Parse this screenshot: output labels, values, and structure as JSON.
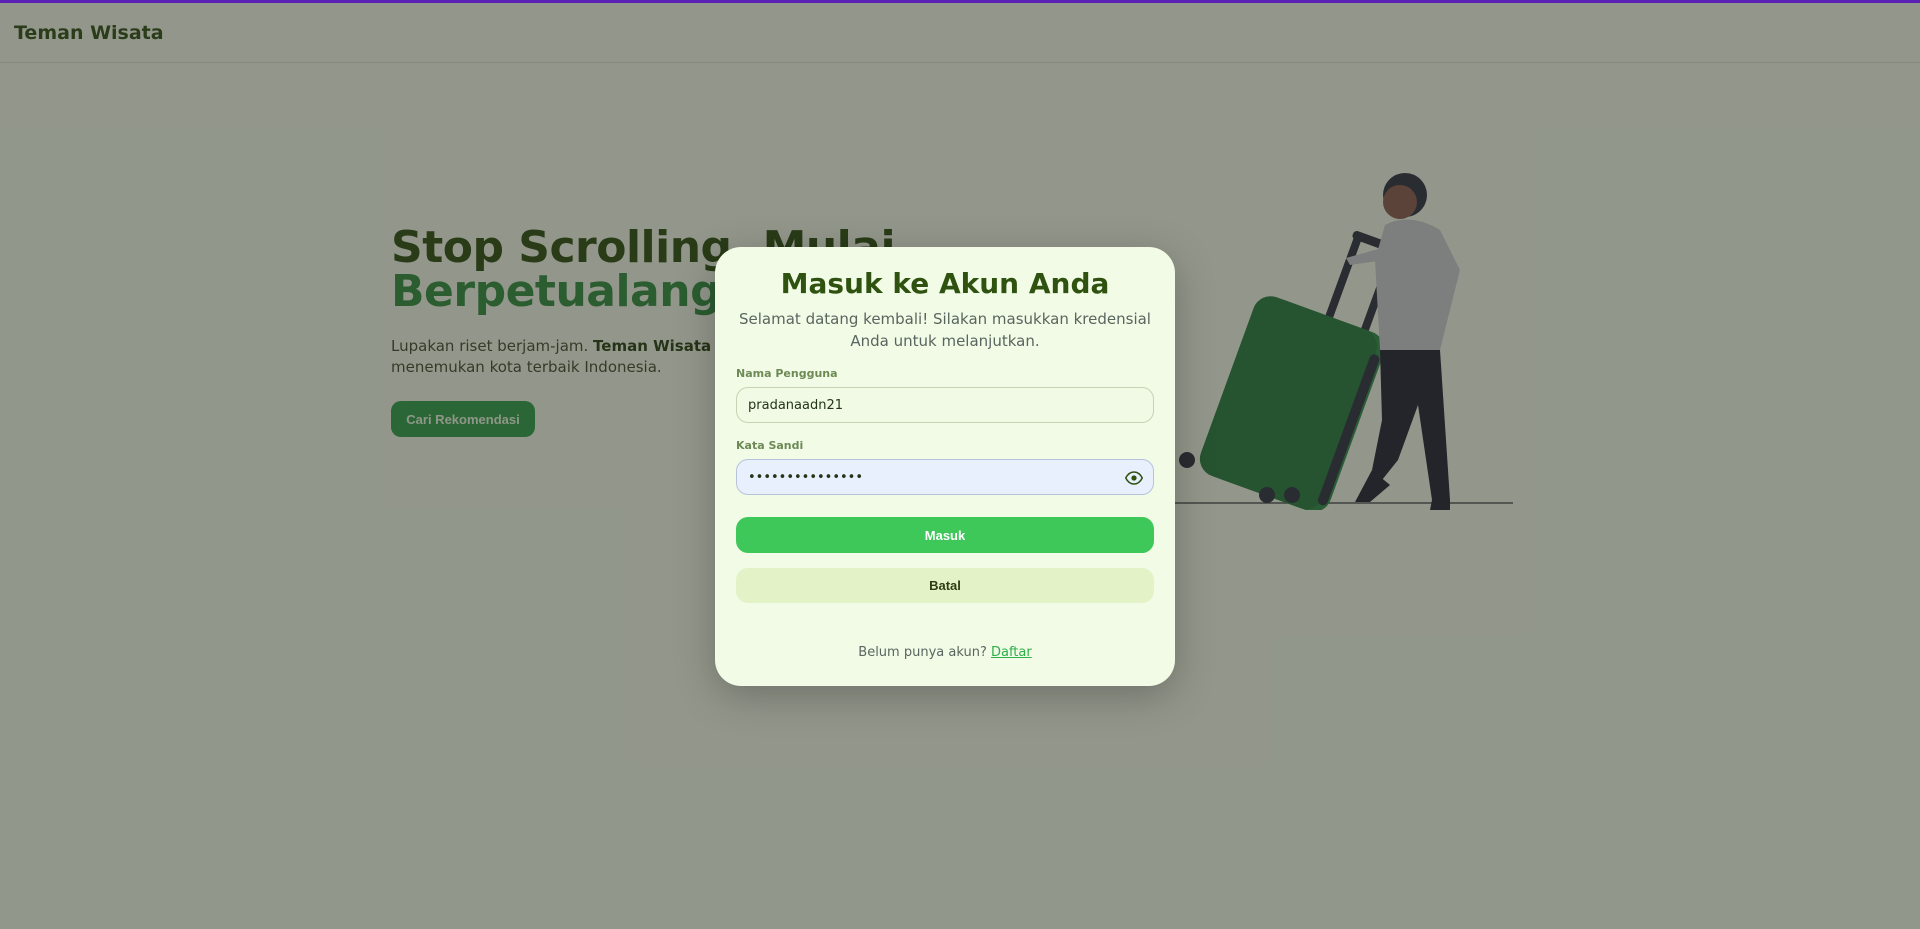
{
  "navbar": {
    "brand": "Teman Wisata"
  },
  "hero": {
    "title_line1": "Stop Scrolling, Mulai",
    "title_line2": "Berpetualang",
    "desc_prefix": "Lupakan riset berjam-jam. ",
    "desc_brand": "Teman Wisata",
    "desc_suffix": " menemukan kota terbaik Indonesia.",
    "cta_label": "Cari Rekomendasi"
  },
  "modal": {
    "title": "Masuk ke Akun Anda",
    "subtitle": "Selamat datang kembali! Silakan masukkan kredensial Anda untuk melanjutkan.",
    "username_label": "Nama Pengguna",
    "username_value": "pradanaadn21",
    "password_label": "Kata Sandi",
    "password_value": "•••••••••••••••",
    "login_label": "Masuk",
    "cancel_label": "Batal",
    "footer_text": "Belum punya akun?",
    "footer_link": "Daftar"
  },
  "colors": {
    "accent": "#3ec85a",
    "heading": "#2f5210",
    "brand_green": "#2e8b3a",
    "top_bar": "#5b21b6"
  },
  "icons": {
    "password_toggle": "eye-icon"
  }
}
